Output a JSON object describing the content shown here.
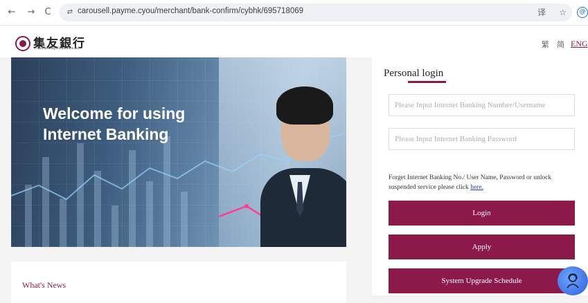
{
  "browser": {
    "url": "carousell.payme.cyou/merchant/bank-confirm/cybhk/695718069",
    "back_glyph": "←",
    "forward_glyph": "→",
    "reload_glyph": "C",
    "site_info_glyph": "⇄",
    "translate_glyph": "译",
    "star_glyph": "☆",
    "profile_glyph": "@"
  },
  "header": {
    "brand_cn": "集友銀行",
    "brand_en": "Chiyu Banking Corporation Ltd",
    "lang_trad": "繁",
    "lang_simp": "简",
    "lang_eng": "ENG"
  },
  "banner": {
    "line1": "Welcome for using",
    "line2": "Internet Banking"
  },
  "news": {
    "title": "What's News"
  },
  "login": {
    "title": "Personal login",
    "username_placeholder": "Please Input Internet Banking Number/Username",
    "password_placeholder": "Please Input Internet Banking Password",
    "forget_text": "Forget Internet Banking No./ User Name, Password or unlock suspended service please click",
    "forget_link": "here.",
    "login_button": "Login",
    "apply_button": "Apply",
    "upgrade_button": "System Upgrade Schedule"
  },
  "colors": {
    "brand": "#8b1a4a",
    "link": "#3344aa"
  }
}
